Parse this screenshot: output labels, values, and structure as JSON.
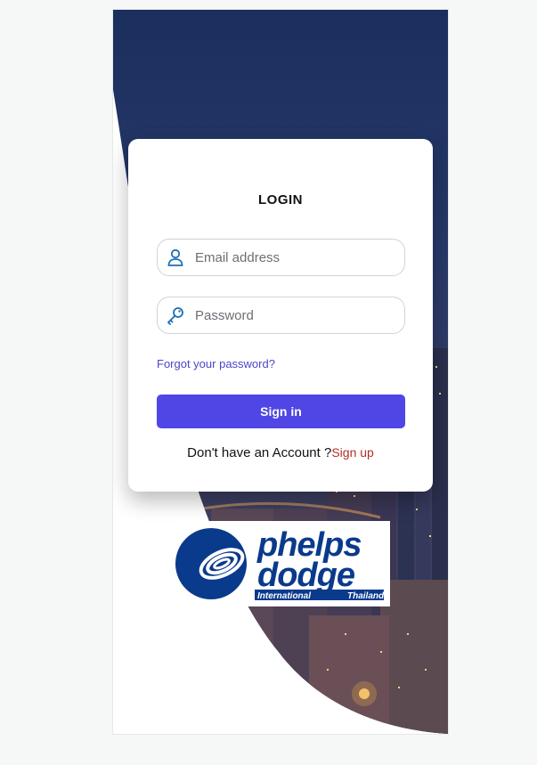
{
  "login": {
    "title": "LOGIN",
    "email_placeholder": "Email address",
    "password_placeholder": "Password",
    "forgot_link": "Forgot your password?",
    "signin_button": "Sign in",
    "no_account_text": "Don't have an Account ?",
    "signup_link": "Sign up"
  },
  "logo": {
    "line1": "phelps",
    "line2": "dodge",
    "left_caption": "International",
    "right_caption": "Thailand"
  },
  "colors": {
    "accent": "#4f46e5",
    "link": "#4b46c9",
    "signup": "#b0302a",
    "logo_blue": "#0a3a8c",
    "icon_blue": "#1a6fb5"
  }
}
